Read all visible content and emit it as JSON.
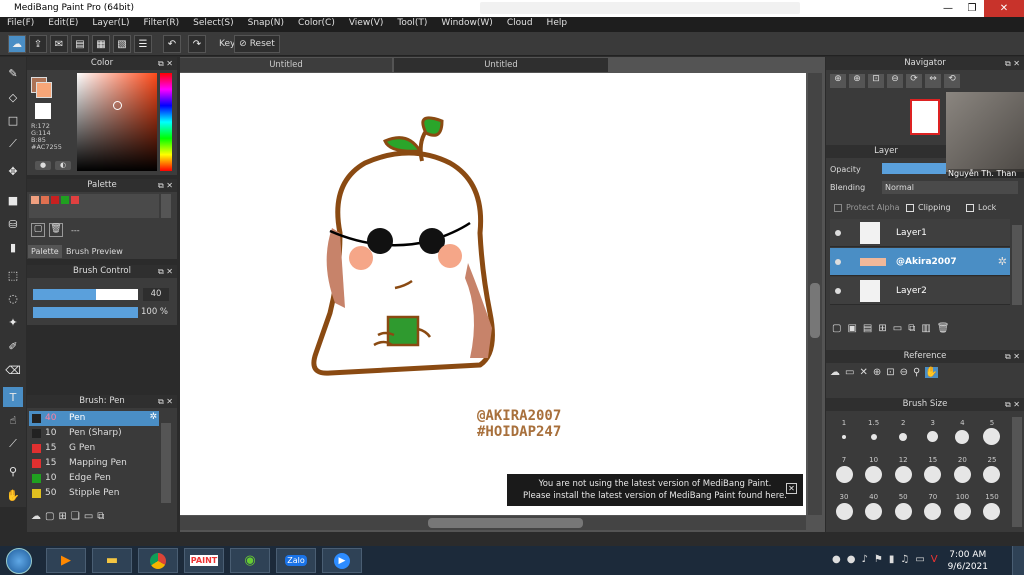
{
  "app": {
    "title": "MediBang Paint Pro (64bit)"
  },
  "menu": [
    "File(F)",
    "Edit(E)",
    "Layer(L)",
    "Filter(R)",
    "Select(S)",
    "Snap(N)",
    "Color(C)",
    "View(V)",
    "Tool(T)",
    "Window(W)",
    "Cloud",
    "Help"
  ],
  "toolbar": {
    "key_label": "Key",
    "reset_label": "Reset"
  },
  "color_panel": {
    "title": "Color",
    "r": "R:172",
    "g": "G:114",
    "b": "B:85",
    "hex": "#AC7255",
    "fg": "#AC7255",
    "bg": "#ffffff"
  },
  "palette_panel": {
    "title": "Palette",
    "swatches": [
      "#f0a080",
      "#e07050",
      "#c82020",
      "#20a020",
      "#e04040"
    ],
    "dash": "---",
    "tabs": [
      "Palette",
      "Brush Preview"
    ]
  },
  "brush_control": {
    "title": "Brush Control",
    "size": "40",
    "opacity": "100 %",
    "size_frac": 0.6,
    "opacity_frac": 1.0
  },
  "brush_list": {
    "title": "Brush: Pen",
    "items": [
      {
        "size": "40",
        "name": "Pen",
        "color": "#222222"
      },
      {
        "size": "10",
        "name": "Pen (Sharp)",
        "color": "#222222"
      },
      {
        "size": "15",
        "name": "G Pen",
        "color": "#e03030"
      },
      {
        "size": "15",
        "name": "Mapping Pen",
        "color": "#e03030"
      },
      {
        "size": "10",
        "name": "Edge Pen",
        "color": "#20a020"
      },
      {
        "size": "50",
        "name": "Stipple Pen",
        "color": "#e0c020"
      }
    ]
  },
  "canvas": {
    "tabs": [
      "Untitled",
      "Untitled"
    ],
    "watermark_1": "@AKIRA2007",
    "watermark_2": "#HOIDAP247"
  },
  "notice": {
    "line1": "You are not using the latest version of MediBang Paint.",
    "line2": "Please install the latest version of MediBang Paint found here."
  },
  "navigator": {
    "title": "Navigator",
    "video_caption": "Nguyễn Th. Than"
  },
  "layer_panel": {
    "title": "Layer",
    "opacity_label": "Opacity",
    "blending_label": "Blending",
    "blending_value": "Normal",
    "protect_alpha": "Protect Alpha",
    "clipping": "Clipping",
    "lock": "Lock",
    "layers": [
      {
        "name": "Layer1"
      },
      {
        "name": "@Akira2007"
      },
      {
        "name": "Layer2"
      }
    ]
  },
  "reference_panel": {
    "title": "Reference"
  },
  "brush_size_panel": {
    "title": "Brush Size",
    "row1": [
      "1",
      "1.5",
      "2",
      "3",
      "4",
      "5"
    ],
    "row2": [
      "7",
      "10",
      "12",
      "15",
      "20",
      "25"
    ],
    "row3": [
      "30",
      "40",
      "50",
      "70",
      "100",
      "150"
    ]
  },
  "taskbar": {
    "time": "7:00 AM",
    "date": "9/6/2021",
    "zalo": "Zalo"
  }
}
